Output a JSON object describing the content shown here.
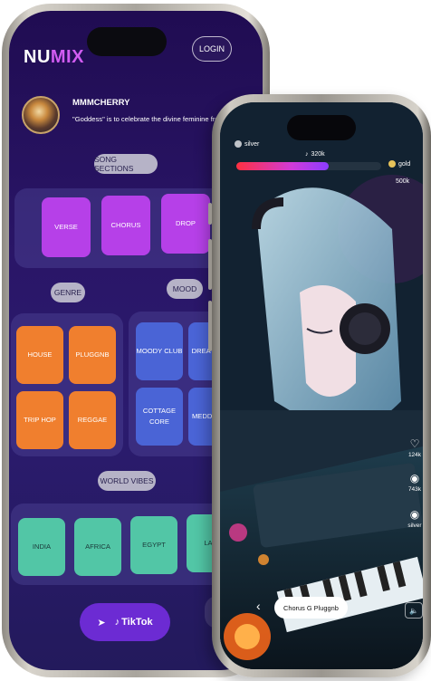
{
  "left_app": {
    "logo_part1": "NU",
    "logo_part2": "MIX",
    "login_label": "LOGIN",
    "profile": {
      "name": "MMMCHERRY",
      "bio": "\"Goddess\" is to celebrate the divine feminine from my eyes ♥"
    },
    "song_sections": {
      "title": "SONG SECTIONS",
      "items": [
        "VERSE",
        "CHORUS",
        "DROP"
      ]
    },
    "genre": {
      "title": "GENRE",
      "items": [
        "HOUSE",
        "PLUGGNB",
        "TRIP HOP",
        "REGGAE"
      ]
    },
    "mood": {
      "title": "MOOD",
      "items": [
        "MOODY CLUB",
        "DREA CORE",
        "COTTAGE CORE",
        "MEDD PART"
      ]
    },
    "world_vibes": {
      "title": "WORLD VIBES",
      "items": [
        "INDIA",
        "AFRICA",
        "EGYPT",
        "LAT"
      ]
    },
    "share_button": {
      "label": "TikTok"
    }
  },
  "right_app": {
    "hud": {
      "left_label": "silver",
      "center_label": "320k",
      "right_label": "gold",
      "right_value": "500k",
      "progress": 0.64
    },
    "actions": [
      {
        "icon": "heart-icon",
        "count": "124k"
      },
      {
        "icon": "eye-icon",
        "count": "743k"
      },
      {
        "icon": "badge-icon",
        "count": "silver"
      }
    ],
    "song_chip": "Chorus G Pluggnb"
  },
  "colors": {
    "purple_tile": "#b640e8",
    "orange_tile": "#f07f2e",
    "blue_tile": "#4a64d6",
    "teal_tile": "#52c6a6",
    "tiktok_button": "#6c2bd3"
  }
}
